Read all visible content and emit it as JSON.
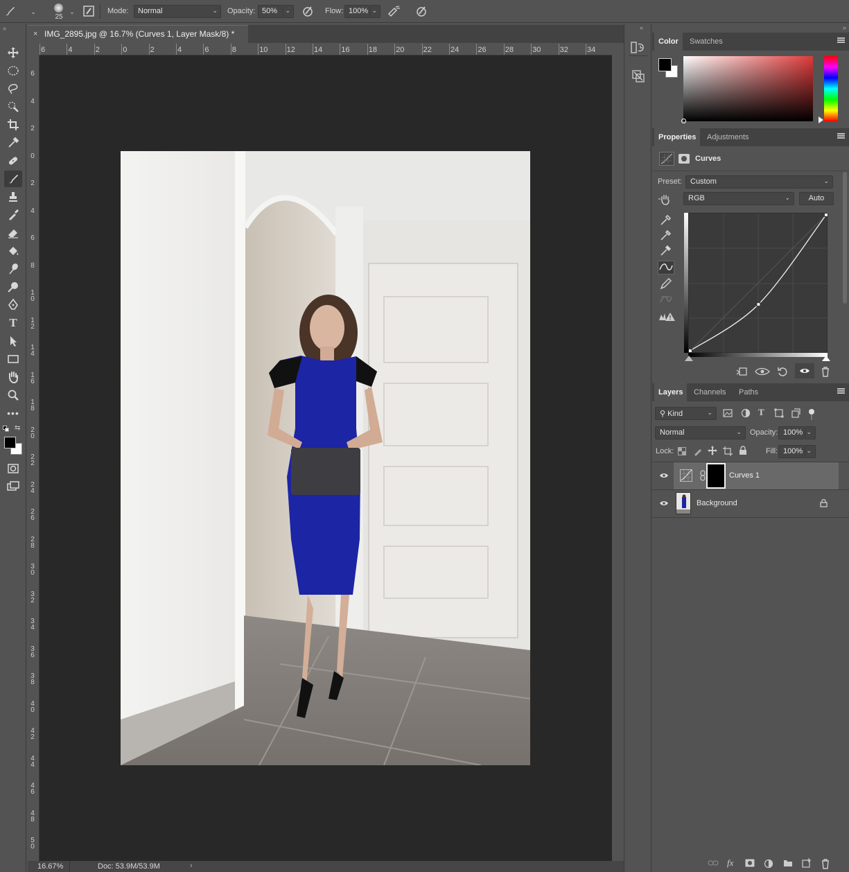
{
  "options_bar": {
    "brush_size": "25",
    "mode_label": "Mode:",
    "mode_value": "Normal",
    "opacity_label": "Opacity:",
    "opacity_value": "50%",
    "flow_label": "Flow:",
    "flow_value": "100%"
  },
  "document": {
    "tab_title": "IMG_2895.jpg @ 16.7% (Curves 1, Layer Mask/8) *",
    "close_glyph": "×",
    "ruler_top": [
      "6",
      "4",
      "2",
      "0",
      "2",
      "4",
      "6",
      "8",
      "10",
      "12",
      "14",
      "16",
      "18",
      "20",
      "22",
      "24",
      "26",
      "28",
      "30",
      "32",
      "34"
    ],
    "ruler_left": [
      "6",
      "4",
      "2",
      "0",
      "2",
      "4",
      "6",
      "8",
      "10",
      "12",
      "14",
      "16",
      "18",
      "20",
      "22",
      "24",
      "26",
      "28",
      "30",
      "32",
      "34",
      "36",
      "38",
      "40",
      "42",
      "44",
      "46",
      "48",
      "50"
    ]
  },
  "status": {
    "zoom": "16.67%",
    "doc_size": "Doc: 53.9M/53.9M",
    "arrow": "›"
  },
  "color_panel": {
    "tabs": [
      "Color",
      "Swatches"
    ],
    "foreground": "#000000",
    "background": "#ffffff",
    "hue": "#e03a3a"
  },
  "properties_panel": {
    "tabs": [
      "Properties",
      "Adjustments"
    ],
    "adjustment_name": "Curves",
    "preset_label": "Preset:",
    "preset_value": "Custom",
    "channel_value": "RGB",
    "auto_label": "Auto"
  },
  "curve": {
    "points": [
      [
        0,
        0
      ],
      [
        128,
        87
      ],
      [
        255,
        255
      ]
    ],
    "input_range": [
      0,
      255
    ],
    "output_range": [
      0,
      255
    ]
  },
  "layers_panel": {
    "tabs": [
      "Layers",
      "Channels",
      "Paths"
    ],
    "filter_label": "Kind",
    "blend_mode": "Normal",
    "opacity_label": "Opacity:",
    "opacity_value": "100%",
    "lock_label": "Lock:",
    "fill_label": "Fill:",
    "fill_value": "100%",
    "layers": [
      {
        "name": "Curves 1",
        "selected": true,
        "visible": true
      },
      {
        "name": "Background",
        "selected": false,
        "visible": true,
        "locked": true
      }
    ]
  }
}
